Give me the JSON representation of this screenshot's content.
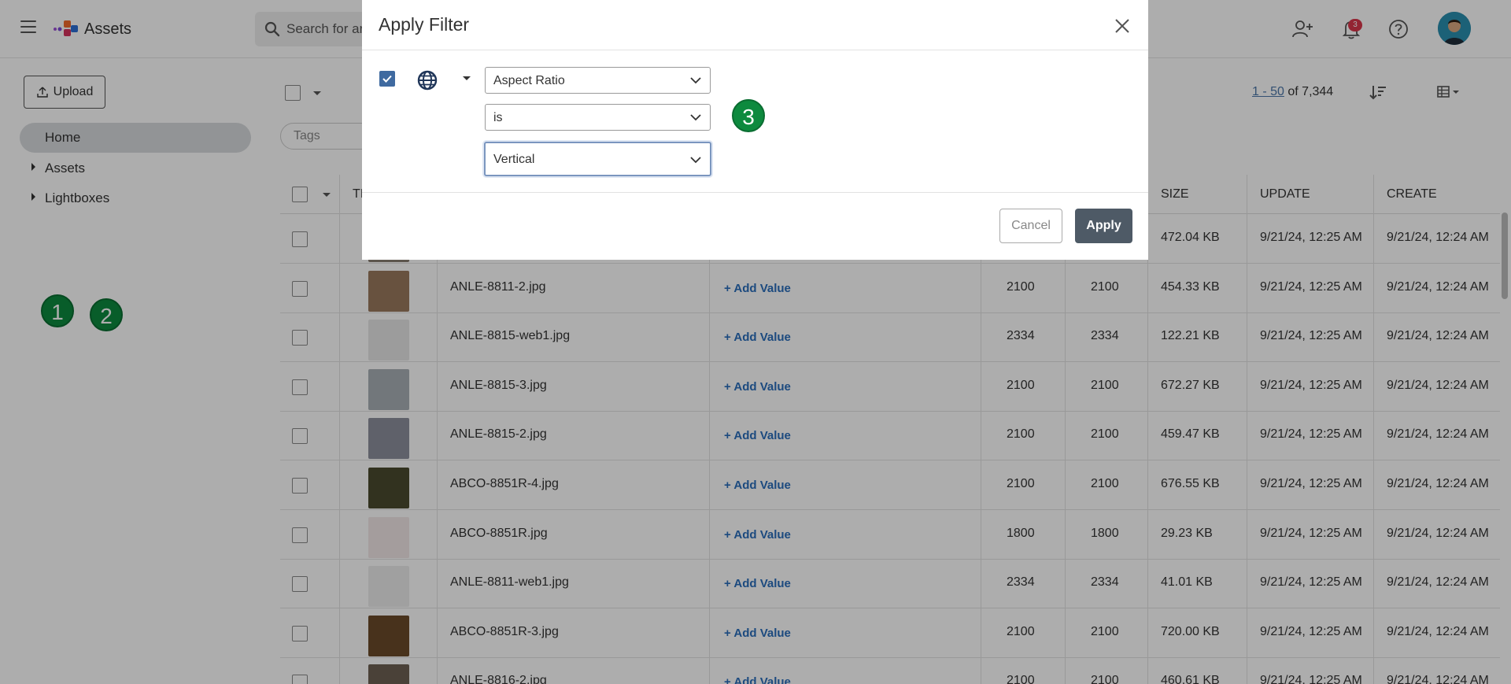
{
  "header": {
    "app_title": "Assets",
    "search_placeholder": "Search for ar",
    "notification_count": "3"
  },
  "sidebar": {
    "upload_label": "Upload",
    "items": [
      {
        "label": "Home"
      },
      {
        "label": "Assets"
      },
      {
        "label": "Lightboxes"
      }
    ]
  },
  "steps": [
    "1",
    "2",
    "3"
  ],
  "toolbar": {
    "tags_placeholder": "Tags",
    "pager_range": "1 - 50",
    "pager_total": "of 7,344"
  },
  "table": {
    "columns": [
      "TI",
      "SIZE",
      "UPDATE",
      "CREATE"
    ],
    "add_value_label": "+ Add Value",
    "rows": [
      {
        "name": "",
        "width": "",
        "height": "",
        "size": "472.04 KB",
        "updated": "9/21/24, 12:25 AM",
        "created": "9/21/24, 12:24 AM",
        "thumb": "#8a7f74"
      },
      {
        "name": "ANLE-8811-2.jpg",
        "width": "2100",
        "height": "2100",
        "size": "454.33 KB",
        "updated": "9/21/24, 12:25 AM",
        "created": "9/21/24, 12:24 AM",
        "thumb": "#9a7a5e"
      },
      {
        "name": "ANLE-8815-web1.jpg",
        "width": "2334",
        "height": "2334",
        "size": "122.21 KB",
        "updated": "9/21/24, 12:25 AM",
        "created": "9/21/24, 12:24 AM",
        "thumb": "#e6e6e6"
      },
      {
        "name": "ANLE-8815-3.jpg",
        "width": "2100",
        "height": "2100",
        "size": "672.27 KB",
        "updated": "9/21/24, 12:25 AM",
        "created": "9/21/24, 12:24 AM",
        "thumb": "#a9b0b6"
      },
      {
        "name": "ANLE-8815-2.jpg",
        "width": "2100",
        "height": "2100",
        "size": "459.47 KB",
        "updated": "9/21/24, 12:25 AM",
        "created": "9/21/24, 12:24 AM",
        "thumb": "#8d8f9c"
      },
      {
        "name": "ABCO-8851R-4.jpg",
        "width": "2100",
        "height": "2100",
        "size": "676.55 KB",
        "updated": "9/21/24, 12:25 AM",
        "created": "9/21/24, 12:24 AM",
        "thumb": "#4b4a2f"
      },
      {
        "name": "ABCO-8851R.jpg",
        "width": "1800",
        "height": "1800",
        "size": "29.23 KB",
        "updated": "9/21/24, 12:25 AM",
        "created": "9/21/24, 12:24 AM",
        "thumb": "#f2e7e7"
      },
      {
        "name": "ANLE-8811-web1.jpg",
        "width": "2334",
        "height": "2334",
        "size": "41.01 KB",
        "updated": "9/21/24, 12:25 AM",
        "created": "9/21/24, 12:24 AM",
        "thumb": "#ececec"
      },
      {
        "name": "ABCO-8851R-3.jpg",
        "width": "2100",
        "height": "2100",
        "size": "720.00 KB",
        "updated": "9/21/24, 12:25 AM",
        "created": "9/21/24, 12:24 AM",
        "thumb": "#6b4a2a"
      },
      {
        "name": "ANLE-8816-2.jpg",
        "width": "2100",
        "height": "2100",
        "size": "460.61 KB",
        "updated": "9/21/24, 12:25 AM",
        "created": "9/21/24, 12:24 AM",
        "thumb": "#6d6153"
      }
    ]
  },
  "modal": {
    "title": "Apply Filter",
    "field_select": "Aspect Ratio",
    "operator_select": "is",
    "value_select": "Vertical",
    "cancel_label": "Cancel",
    "apply_label": "Apply"
  },
  "colors": {
    "accent_step": "#0d8a3e",
    "apply_button": "#4e5a66",
    "checkbox_checked": "#3f6aa0",
    "add_value_link": "#2a6ebb"
  }
}
